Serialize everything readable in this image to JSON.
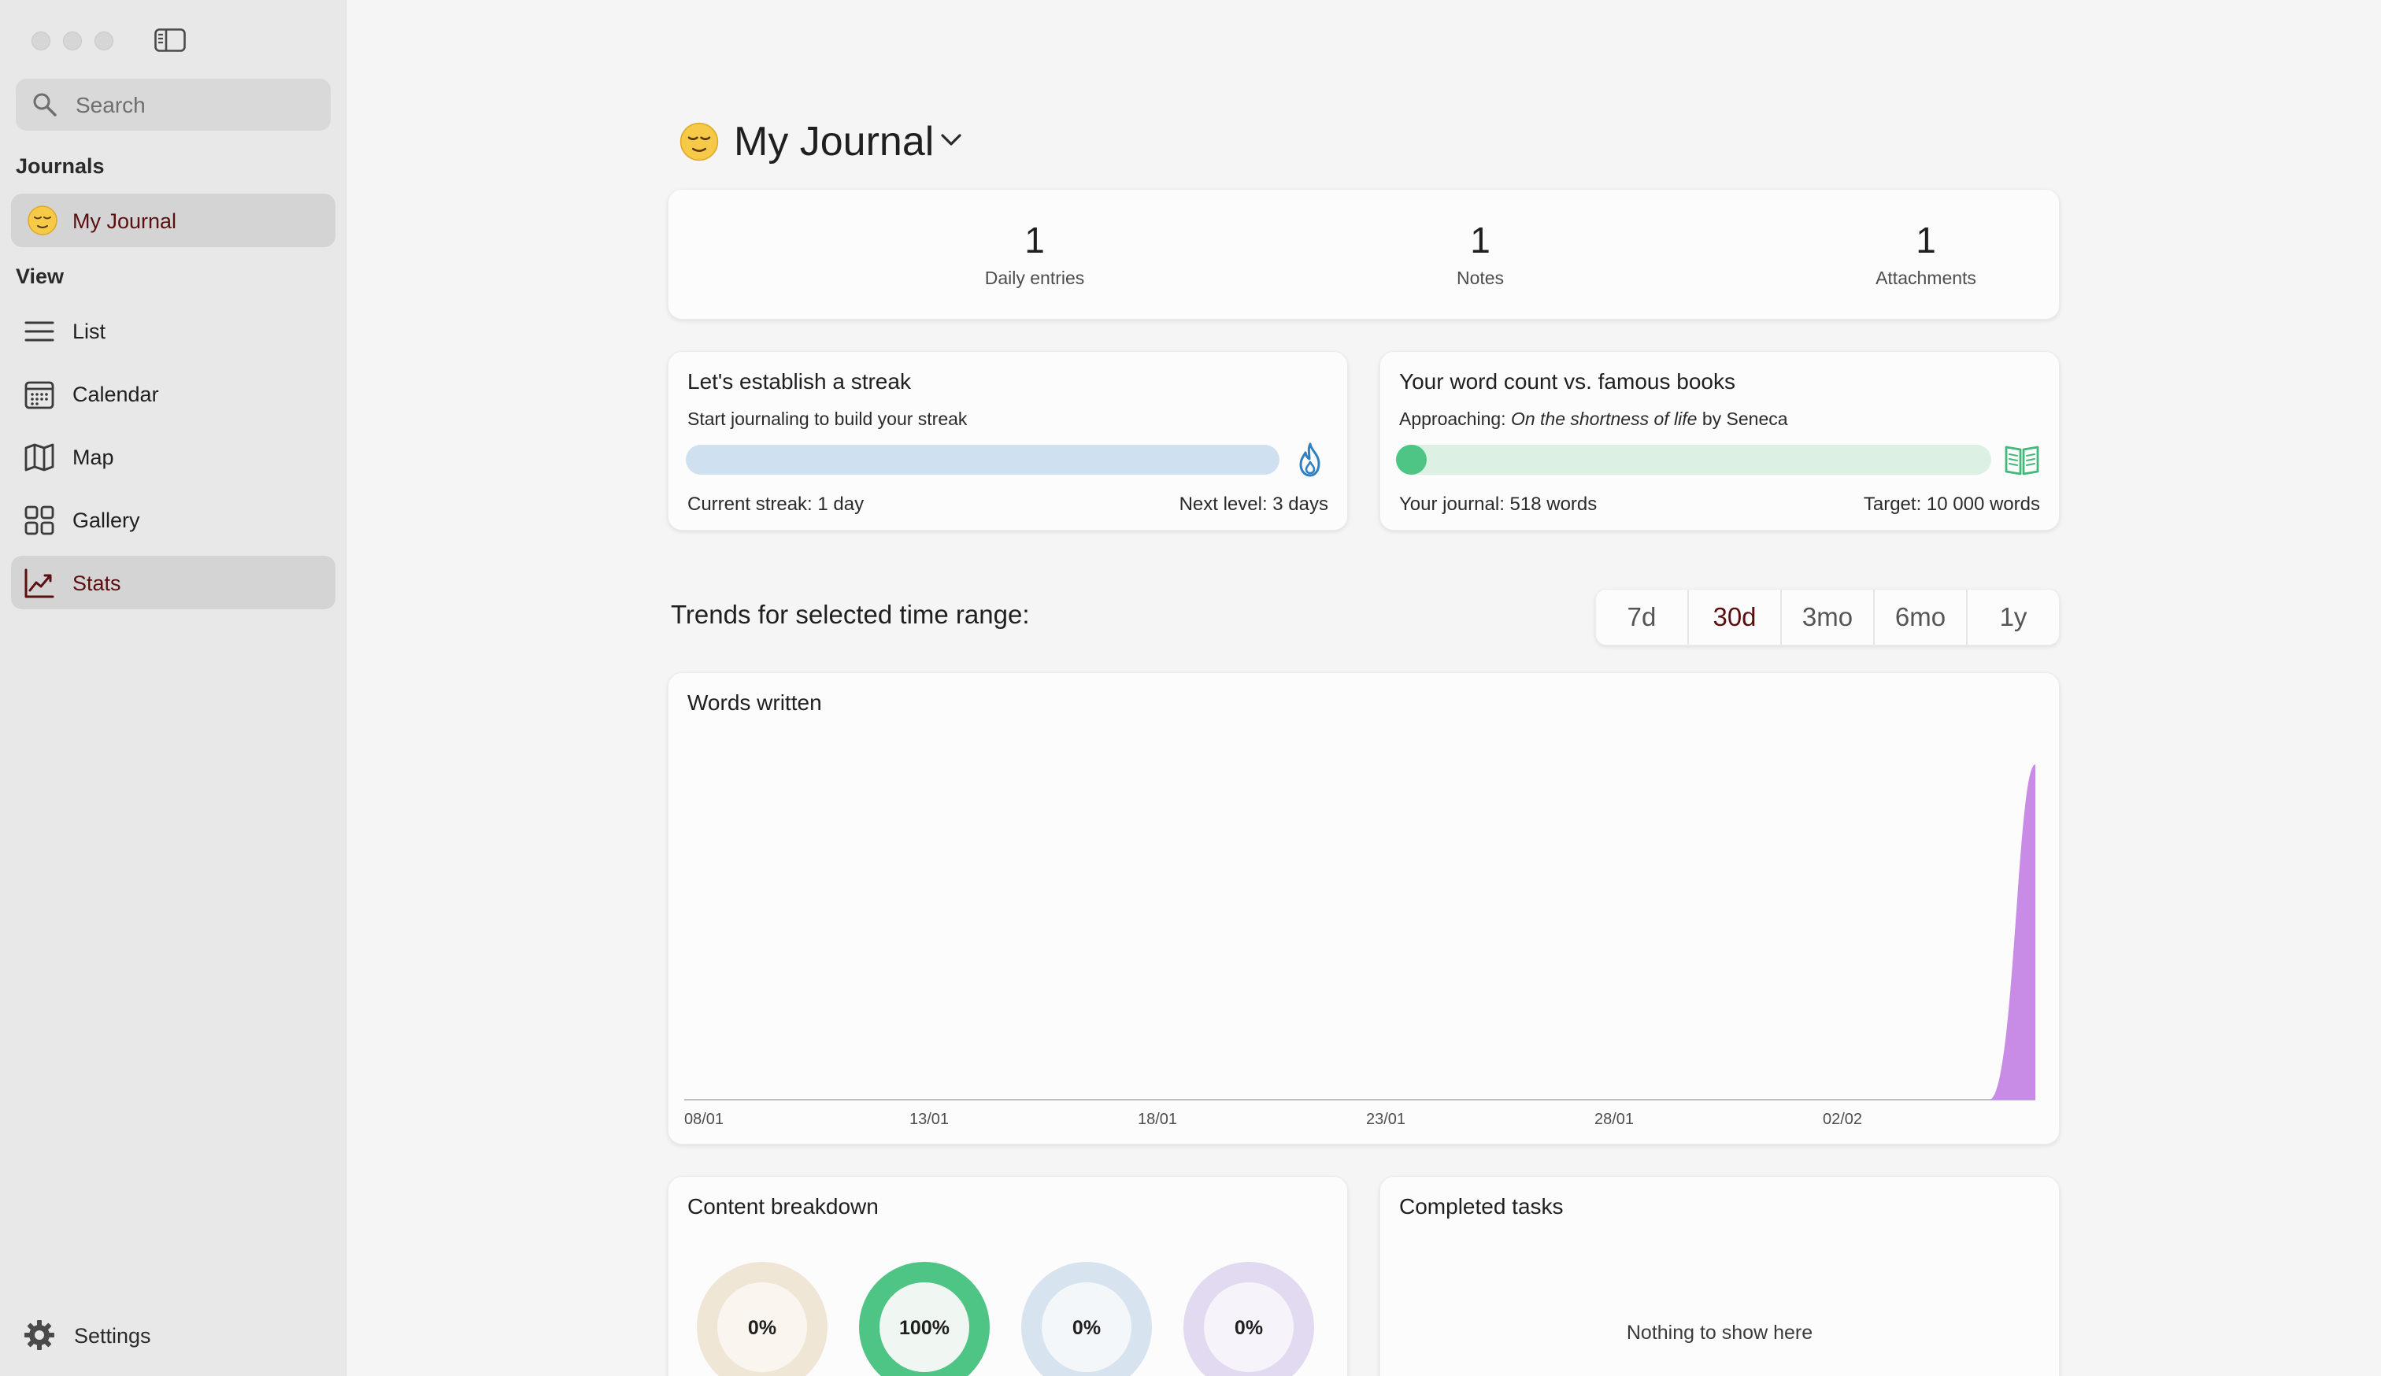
{
  "sidebar": {
    "search_placeholder": "Search",
    "journals_heading": "Journals",
    "journals": [
      {
        "label": "My Journal",
        "icon": "relieved-face-emoji"
      }
    ],
    "view_heading": "View",
    "views": [
      {
        "label": "List",
        "icon": "list-icon"
      },
      {
        "label": "Calendar",
        "icon": "calendar-icon"
      },
      {
        "label": "Map",
        "icon": "map-icon"
      },
      {
        "label": "Gallery",
        "icon": "gallery-icon"
      },
      {
        "label": "Stats",
        "icon": "stats-icon",
        "active": true
      }
    ],
    "settings_label": "Settings"
  },
  "main": {
    "journal_title": "My Journal",
    "summary": [
      {
        "value": "1",
        "label": "Daily entries"
      },
      {
        "value": "1",
        "label": "Notes"
      },
      {
        "value": "1",
        "label": "Attachments"
      }
    ],
    "streak": {
      "title": "Let's establish a streak",
      "subtitle": "Start journaling to build your streak",
      "current": "Current streak: 1 day",
      "next": "Next level: 3 days",
      "progress": 0,
      "color": "#cfe0f0",
      "icon": "flame-icon"
    },
    "books": {
      "title": "Your word count vs. famous books",
      "approaching_prefix": "Approaching: ",
      "book_title": "On the shortness of life",
      "approaching_suffix": " by Seneca",
      "your_journal": "Your journal: 518 words",
      "target": "Target: 10 000 words",
      "progress": 0.0518,
      "color": "#4fc585",
      "track_color": "#dcf0e3",
      "icon": "open-book-icon"
    },
    "trends_label": "Trends for selected time range:",
    "ranges": [
      "7d",
      "30d",
      "3mo",
      "6mo",
      "1y"
    ],
    "selected_range": "30d",
    "words_card_title": "Words written",
    "content_breakdown_title": "Content breakdown",
    "completed_tasks_title": "Completed tasks",
    "completed_tasks_empty": "Nothing to show here"
  },
  "chart_data": {
    "type": "area",
    "title": "Words written",
    "x_tick_labels": [
      "08/01",
      "13/01",
      "18/01",
      "23/01",
      "28/01",
      "02/02"
    ],
    "x": [
      "08/01",
      "09/01",
      "10/01",
      "11/01",
      "12/01",
      "13/01",
      "14/01",
      "15/01",
      "16/01",
      "17/01",
      "18/01",
      "19/01",
      "20/01",
      "21/01",
      "22/01",
      "23/01",
      "24/01",
      "25/01",
      "26/01",
      "27/01",
      "28/01",
      "29/01",
      "30/01",
      "31/01",
      "01/02",
      "02/02",
      "03/02",
      "04/02",
      "05/02",
      "06/02"
    ],
    "series": [
      {
        "values": [
          0,
          0,
          0,
          0,
          0,
          0,
          0,
          0,
          0,
          0,
          0,
          0,
          0,
          0,
          0,
          0,
          0,
          0,
          0,
          0,
          0,
          0,
          0,
          0,
          0,
          0,
          0,
          0,
          0,
          518
        ],
        "color": "#c88be6"
      }
    ],
    "grid": false
  },
  "breakdown": [
    {
      "value": 0,
      "label": "0%",
      "color": "#f0e6d6",
      "inner": "#faf6ef"
    },
    {
      "value": 1,
      "label": "100%",
      "color": "#4fc585",
      "inner": "#f0f7f2"
    },
    {
      "value": 0,
      "label": "0%",
      "color": "#d7e4ef",
      "inner": "#f3f7fa"
    },
    {
      "value": 0,
      "label": "0%",
      "color": "#e1daf0",
      "inner": "#f6f3fa"
    }
  ]
}
